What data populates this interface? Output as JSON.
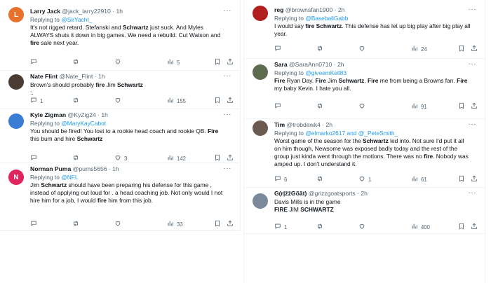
{
  "left": [
    {
      "id": "larry",
      "name": "Larry Jack",
      "handle": "@jack_larry22910",
      "time": "1h",
      "avatar_letter": "L",
      "avatar_color": "#e8712b",
      "reply_prefix": "Replying to ",
      "reply_to": "@SirYacht_",
      "lines": [
        [
          {
            "t": "It's not rigged retard. Stefanski and "
          },
          {
            "t": "Schwartz",
            "b": true
          },
          {
            "t": " just suck. And Myles"
          }
        ],
        [
          {
            "t": "ALWAYS shuts it down in big games. We need a rebuild. Cut Watson and"
          }
        ],
        [
          {
            "b": true,
            "t": "fire"
          },
          {
            "t": " sale next year."
          }
        ]
      ],
      "replies": "",
      "retweets": "",
      "likes": "",
      "views": "5"
    },
    {
      "id": "nate",
      "name": "Nate Flint",
      "handle": "@Nate_Flint",
      "time": "1h",
      "avatar_letter": "",
      "avatar_color": "#4a3b33",
      "lines": [
        [
          {
            "t": "Brown's should probably "
          },
          {
            "b": true,
            "t": "fire"
          },
          {
            "t": " Jim "
          },
          {
            "b": true,
            "t": "Schwartz"
          }
        ],
        [
          {
            "t": ":."
          }
        ]
      ],
      "replies": "1",
      "retweets": "",
      "likes": "",
      "views": "155"
    },
    {
      "id": "kyle",
      "name": "Kyle Zigman",
      "handle": "@KyZig24",
      "time": "1h",
      "avatar_letter": "",
      "avatar_color": "#3a7bd5",
      "reply_prefix": "Replying to ",
      "reply_to": "@MaryKayCabot",
      "lines": [
        [
          {
            "t": "You should be fired! You lost to a rookie head coach and rookie QB. "
          },
          {
            "b": true,
            "t": "Fire"
          }
        ],
        [
          {
            "t": "this bum and hire "
          },
          {
            "b": true,
            "t": "Schwartz"
          }
        ]
      ],
      "replies": "",
      "retweets": "",
      "likes": "3",
      "views": "142"
    },
    {
      "id": "norman",
      "name": "Norman Puma",
      "handle": "@pums5656",
      "time": "1h",
      "avatar_letter": "N",
      "avatar_color": "#e0245e",
      "reply_prefix": "Replying to ",
      "reply_to": "@NFL",
      "lines": [
        [
          {
            "t": "Jim "
          },
          {
            "b": true,
            "t": "Schwartz"
          },
          {
            "t": " should have been preparing his defense for this game ,"
          }
        ],
        [
          {
            "t": "instead of applying out loud for . a head coaching job. Not only would I not"
          }
        ],
        [
          {
            "t": "hire him for a job, I would "
          },
          {
            "b": true,
            "t": "fire"
          },
          {
            "t": " him from this job."
          }
        ]
      ],
      "replies": "",
      "retweets": "",
      "likes": "",
      "views": "33"
    }
  ],
  "right": [
    {
      "id": "reg",
      "name": "reg",
      "handle": "@brownsfan1900",
      "time": "2h",
      "avatar_letter": "",
      "avatar_color": "#b21f1f",
      "reply_prefix": "Replying to ",
      "reply_to": "@BaseballGabb",
      "lines": [
        [
          {
            "t": "I would say "
          },
          {
            "b": true,
            "t": "fire Schwartz"
          },
          {
            "t": ". This defense has let up big play after big play all"
          }
        ],
        [
          {
            "t": "year."
          }
        ]
      ],
      "replies": "",
      "retweets": "",
      "likes": "",
      "views": "24"
    },
    {
      "id": "sara",
      "name": "Sara",
      "handle": "@SaraAnn0710",
      "time": "2h",
      "avatar_letter": "",
      "avatar_color": "#5d6b4e",
      "reply_prefix": "Replying to ",
      "reply_to": "@giveemKell83",
      "lines": [
        [
          {
            "b": true,
            "t": "Fire"
          },
          {
            "t": " Ryan Day. "
          },
          {
            "b": true,
            "t": "Fire"
          },
          {
            "t": " Jim "
          },
          {
            "b": true,
            "t": "Schwartz"
          },
          {
            "t": ". "
          },
          {
            "b": true,
            "t": "Fire"
          },
          {
            "t": " me from being a Browns fan. "
          },
          {
            "b": true,
            "t": "Fire"
          }
        ],
        [
          {
            "t": "my baby Kevin. I hate you all."
          }
        ]
      ],
      "replies": "",
      "retweets": "",
      "likes": "",
      "views": "91"
    },
    {
      "id": "tim",
      "name": "Tim",
      "handle": "@trobdawk4",
      "time": "2h",
      "avatar_letter": "",
      "avatar_color": "#6b5a4f",
      "reply_prefix": "Replying to ",
      "reply_to": "@elmarko2617 and @_PeteSmith_",
      "lines": [
        [
          {
            "t": "Worst game of the season for the "
          },
          {
            "b": true,
            "t": "Schwartz"
          },
          {
            "t": " led into. Not sure I'd put it all"
          }
        ],
        [
          {
            "t": "on him though, Newsome was exposed badly today and the rest of the"
          }
        ],
        [
          {
            "t": "group just kinda went through the motions. There was no "
          },
          {
            "b": true,
            "t": "fire"
          },
          {
            "t": ". Nobody was"
          }
        ],
        [
          {
            "t": "amped up. I don't understand it."
          }
        ]
      ],
      "replies": "6",
      "retweets": "",
      "likes": "1",
      "views": "61"
    },
    {
      "id": "grizz",
      "name": "G(r|žžGõãt)",
      "handle": "@grizzgoatsports",
      "time": "2h",
      "avatar_letter": "",
      "avatar_color": "#7a8a9a",
      "lines": [
        [
          {
            "t": "Davis Mills is in the game"
          }
        ],
        [
          {
            "b": true,
            "t": "FIRE"
          },
          {
            "t": " JIM "
          },
          {
            "b": true,
            "t": "SCHWARTZ"
          }
        ]
      ],
      "replies": "1",
      "retweets": "",
      "likes": "",
      "views": "400"
    }
  ],
  "colors": {
    "link": "#1d9bf0",
    "muted": "#536471",
    "text": "#0f1419",
    "border": "#eff3f4"
  },
  "icons": [
    "reply-icon",
    "retweet-icon",
    "like-icon",
    "views-icon",
    "bookmark-icon",
    "share-icon",
    "more-icon"
  ]
}
